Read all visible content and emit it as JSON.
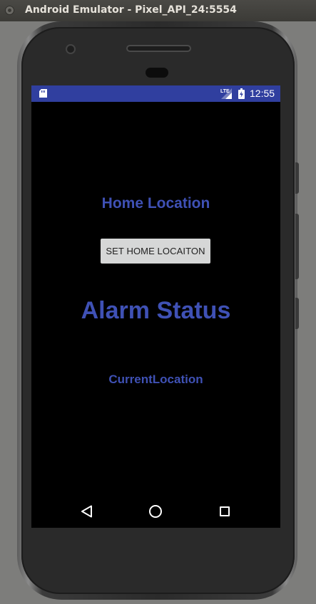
{
  "window": {
    "title": "Android Emulator - Pixel_API_24:5554"
  },
  "statusbar": {
    "time": "12:55",
    "network": "LTE",
    "icons": [
      "sd-card-icon",
      "lte-signal-icon",
      "battery-charging-icon"
    ],
    "color": "#303f9f"
  },
  "app": {
    "home_location_label": "Home Location",
    "set_home_button_label": "SET HOME LOCAITON",
    "alarm_status_label": "Alarm Status",
    "current_location_label": "CurrentLocation",
    "accent_color": "#3f51b5",
    "background_color": "#000000"
  },
  "navbar": {
    "icons": [
      "back-icon",
      "home-icon",
      "recents-icon"
    ]
  }
}
